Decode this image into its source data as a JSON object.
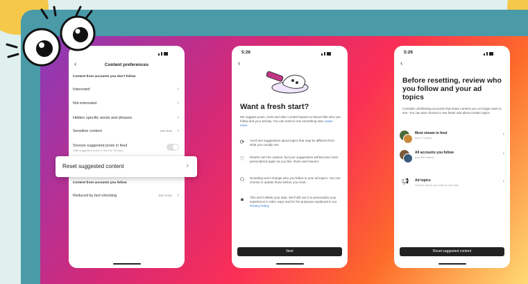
{
  "phone1": {
    "title": "Content preferences",
    "section1": "Content from accounts you don't follow",
    "rows": [
      {
        "label": "Interested"
      },
      {
        "label": "Not interested"
      },
      {
        "label": "Hidden specific words and phrases"
      },
      {
        "label": "Sensitive content",
        "note": "See less"
      },
      {
        "label": "Snooze suggested posts in feed",
        "sub": "Hide suggested posts in feed for 30 days"
      }
    ],
    "highlight": "Reset suggested content",
    "section2": "Content from accounts you follow",
    "row_last": {
      "label": "Reduced by fact-checking",
      "note": "See more"
    }
  },
  "phone2": {
    "time": "5:26",
    "heading": "Want a fresh start?",
    "intro": "We suggest posts, reels and other content based on factors like who you follow and your activity. You can reset to see something new.",
    "learn_more": "Learn more.",
    "bullets": [
      {
        "icon": "refresh-icon",
        "text": "You'll see suggestions about topics that may be different from what you usually see."
      },
      {
        "icon": "heart-icon",
        "text": "Resets can't be undone, but your suggestions will become more personalized again as you like, share and interact."
      },
      {
        "icon": "people-icon",
        "text": "Resetting won't change who you follow or your ad topics. You can choose to update those before you reset."
      },
      {
        "icon": "lock-icon",
        "text": "This won't delete your data. We'll still use it to personalize your experience in other ways and for the purposes explained in our",
        "link": "Privacy Policy."
      }
    ],
    "button": "Next"
  },
  "phone3": {
    "time": "5:26",
    "heading": "Before resetting, review who you follow and your ad topics",
    "intro": "Consider unfollowing accounts that share content you no longer want to see. You can also choose to see fewer ads about certain topics.",
    "accounts": [
      {
        "title": "Most shown in feed",
        "sub": "and 17 others"
      },
      {
        "title": "All accounts you follow",
        "sub": "and 308 others"
      }
    ],
    "ad_topics": {
      "title": "Ad topics",
      "sub": "Choose topics you want to see less"
    },
    "button": "Reset suggested content"
  }
}
